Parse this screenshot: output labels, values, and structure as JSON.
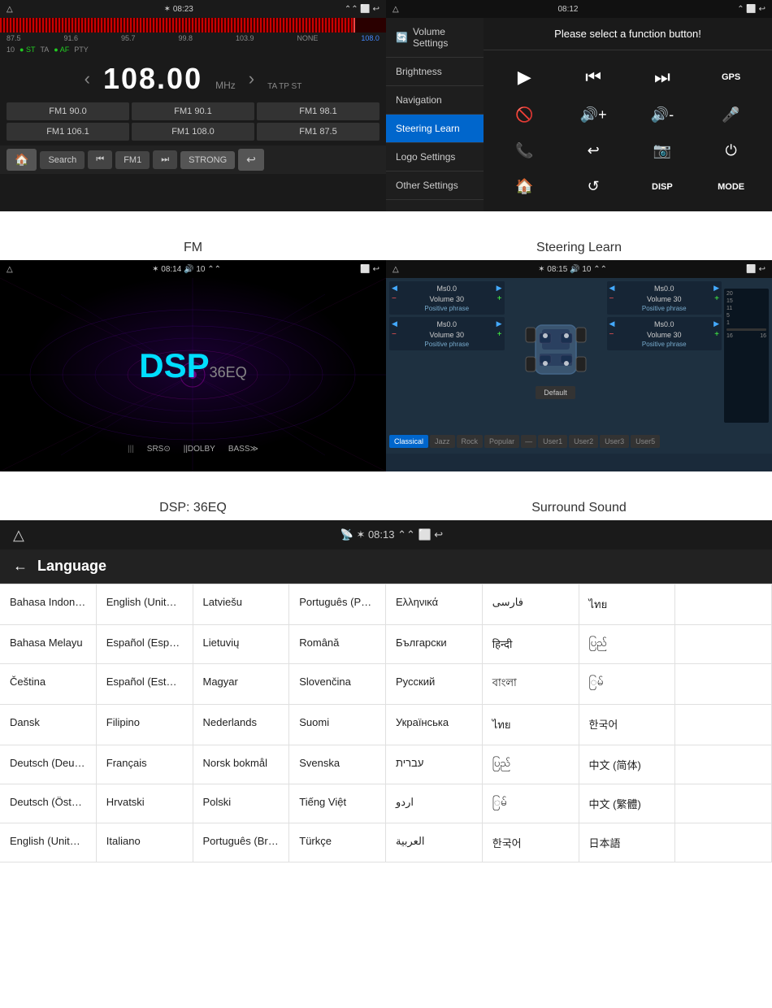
{
  "fm": {
    "status": {
      "time": "08:23",
      "left_icon": "home",
      "bluetooth": "BT",
      "arrows": "^^"
    },
    "freq": "108.00",
    "unit": "MHz",
    "scale": [
      {
        "val": "87.5",
        "active": false
      },
      {
        "val": "91.6",
        "active": false
      },
      {
        "val": "95.7",
        "active": false
      },
      {
        "val": "99.8",
        "active": false
      },
      {
        "val": "103.9",
        "active": false
      },
      {
        "val": "NONE",
        "active": false
      },
      {
        "val": "108.0",
        "active": true
      }
    ],
    "tags": [
      "10",
      "ST",
      "TA",
      "AF",
      "PTY"
    ],
    "ta_tp_st": "TA TP ST",
    "presets": [
      "FM1 90.0",
      "FM1 90.1",
      "FM1 98.1",
      "FM1 106.1",
      "FM1 108.0",
      "FM1 87.5"
    ],
    "toolbar": [
      "🏠",
      "Search",
      "⏮",
      "FM1",
      "⏭",
      "STRONG",
      "↩"
    ]
  },
  "steering": {
    "status_time": "08:12",
    "prompt": "Please select a function button!",
    "menu": [
      {
        "label": "Volume Settings",
        "active": false,
        "icon": "🔄"
      },
      {
        "label": "Brightness",
        "active": false
      },
      {
        "label": "Navigation",
        "active": false
      },
      {
        "label": "Steering Learn",
        "active": true
      },
      {
        "label": "Logo Settings",
        "active": false
      },
      {
        "label": "Other Settings",
        "active": false
      }
    ],
    "buttons": [
      {
        "icon": "▶",
        "label": "play"
      },
      {
        "icon": "⏮",
        "label": "prev"
      },
      {
        "icon": "⏭",
        "label": "next"
      },
      {
        "icon": "GPS",
        "label": "gps"
      },
      {
        "icon": "🚫",
        "label": "mute"
      },
      {
        "icon": "🔊+",
        "label": "vol-up"
      },
      {
        "icon": "🔊-",
        "label": "vol-down"
      },
      {
        "icon": "🎤",
        "label": "mic"
      },
      {
        "icon": "📞",
        "label": "call"
      },
      {
        "icon": "🔁",
        "label": "repeat"
      },
      {
        "icon": "📷",
        "label": "camera"
      },
      {
        "icon": "⏻",
        "label": "power"
      },
      {
        "icon": "🏠",
        "label": "home"
      },
      {
        "icon": "↩",
        "label": "back"
      },
      {
        "icon": "DISP",
        "label": "disp"
      },
      {
        "icon": "MODE",
        "label": "mode"
      }
    ]
  },
  "dsp": {
    "status_time": "08:14",
    "volume": "10",
    "title": "DSP",
    "eq_label": "36EQ",
    "features": [
      "|||",
      "SRS⊙",
      "||DOLBY",
      "BASS≫"
    ]
  },
  "surround": {
    "status_time": "08:15",
    "volume": "10",
    "tabs": [
      "Classical",
      "Jazz",
      "Rock",
      "Popular",
      "",
      "User1",
      "User2",
      "User3",
      "User5"
    ],
    "controls": [
      {
        "name": "Ms0.0",
        "vol": "Volume 30",
        "phrase": "Positive phrase"
      },
      {
        "name": "Ms0.0",
        "vol": "Volume 30",
        "phrase": "Positive phrase"
      },
      {
        "name": "Ms0.0",
        "vol": "Volume 30",
        "phrase": "Positive phrase"
      },
      {
        "name": "Ms0.0",
        "vol": "Volume 30",
        "phrase": "Positive phrase"
      }
    ],
    "default_btn": "Default"
  },
  "captions": {
    "fm": "FM",
    "steering": "Steering Learn",
    "dsp": "DSP: 36EQ",
    "surround": "Surround Sound"
  },
  "language": {
    "status_time": "08:13",
    "title": "Language",
    "back": "←",
    "languages": [
      "Bahasa Indonesia",
      "English (United States)",
      "Latviešu",
      "Português (Portugal)",
      "Ελληνικά",
      "فارسی",
      "ไทย",
      "Bahasa Melayu",
      "Español (España)",
      "Lietuvių",
      "Română",
      "Български",
      "हिन्दी",
      "ပြည်",
      "Čeština",
      "Español (Estados Unidos)",
      "Magyar",
      "Slovenčina",
      "Русский",
      "বাংলা",
      "ြမ်",
      "Dansk",
      "Filipino",
      "Nederlands",
      "Suomi",
      "Українська",
      "ไทย",
      "한국어",
      "Deutsch (Deutschland)",
      "Français",
      "Norsk bokmål",
      "Svenska",
      "עברית",
      "ပြည်",
      "中文 (简体)",
      "Deutsch (Österreich)",
      "Hrvatski",
      "Polski",
      "Tiếng Việt",
      "اردو",
      "ြမ်",
      "中文 (繁體)",
      "English (United Kingdom)",
      "Italiano",
      "Português (Brasil)",
      "Türkçe",
      "العربية",
      "한국어",
      "日本語"
    ]
  }
}
